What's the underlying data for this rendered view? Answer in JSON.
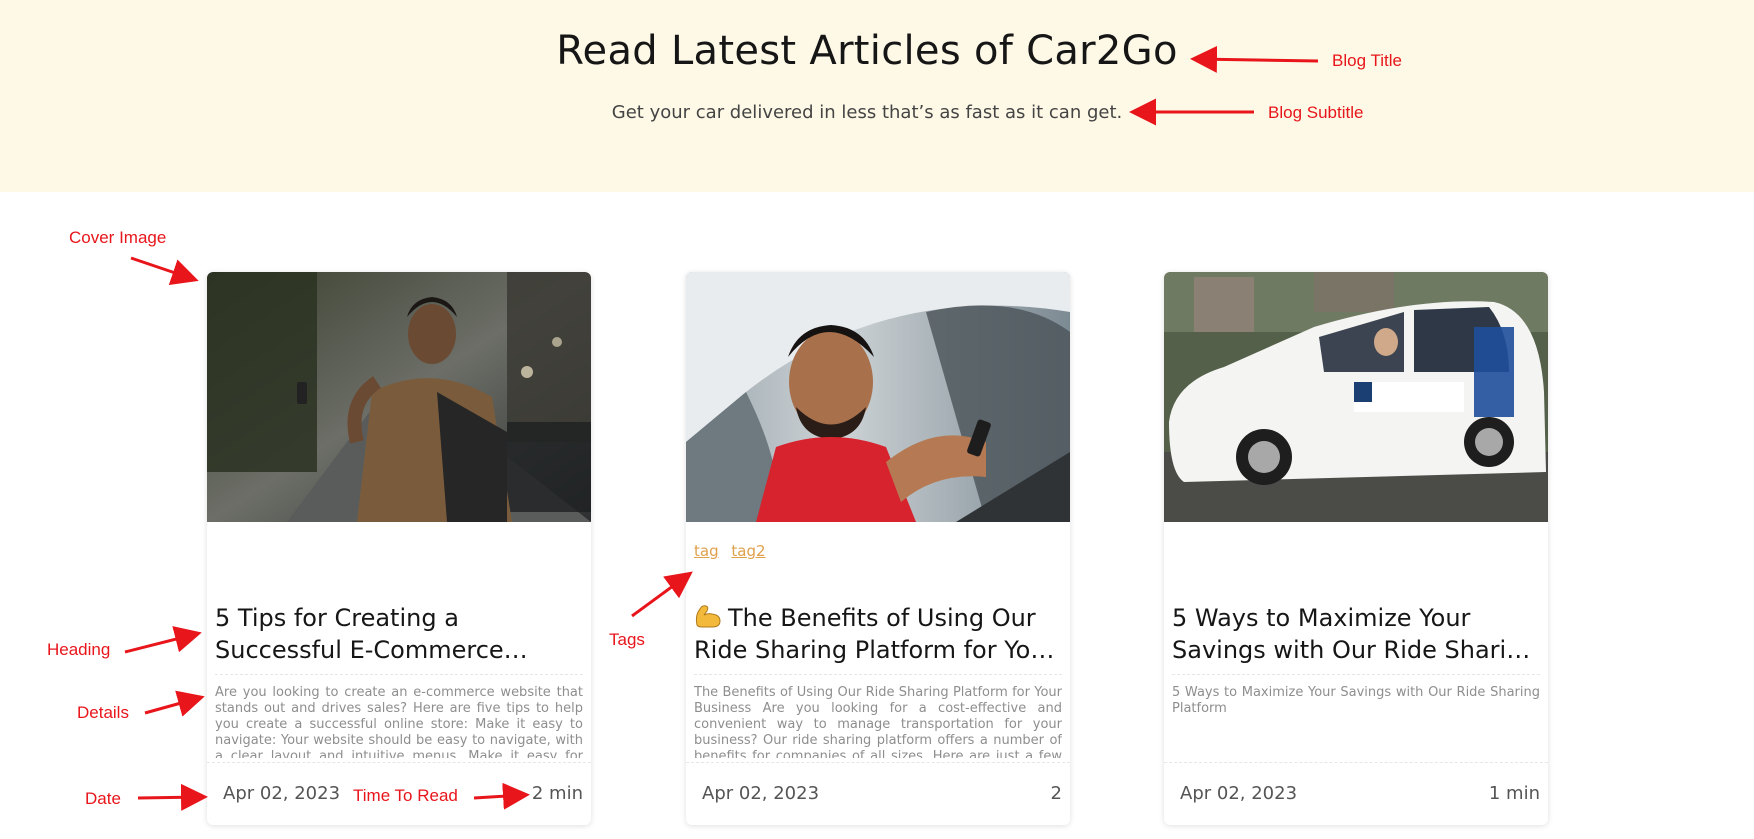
{
  "hero": {
    "title": "Read Latest Articles of Car2Go",
    "subtitle": "Get your car delivered in less that’s as fast as it can get."
  },
  "cards": [
    {
      "cover_alt": "young man holding phone on street",
      "tags": [],
      "heading_line1": "5 Tips for Creating a",
      "heading_line2": "Successful E-Commerce…",
      "details": "Are you looking to create an e-commerce website that stands out and drives sales? Here are five tips to help you create a successful online store: Make it easy to navigate: Your website should be easy to navigate, with a clear layout and intuitive menus. Make it easy for visitors to find wh…",
      "date": "Apr 02, 2023",
      "read_time": "2 min"
    },
    {
      "cover_alt": "man driving car holding phone",
      "tags": [
        "tag",
        "tag2"
      ],
      "heading_icon": "flexed-biceps-icon",
      "heading_line1": "The Benefits of Using Our",
      "heading_line2": "Ride Sharing Platform for You…",
      "details": "The Benefits of Using Our Ride Sharing Platform for Your Business Are you looking for a cost-effective and convenient way to manage transportation for your business? Our ride sharing platform offers a number of benefits for companies of all sizes. Here are just a few reasons why you shoul…",
      "date": "Apr 02, 2023",
      "read_time": "2"
    },
    {
      "cover_alt": "white minivan taxi",
      "tags": [],
      "heading_line1": "5 Ways to Maximize Your",
      "heading_line2": "Savings with Our Ride Sharin…",
      "details": "5 Ways to Maximize Your Savings with Our Ride Sharing Platform",
      "date": "Apr 02, 2023",
      "read_time": "1 min"
    }
  ],
  "annotations": {
    "blog_title": "Blog Title",
    "blog_subtitle": "Blog Subtitle",
    "cover_image": "Cover Image",
    "heading": "Heading",
    "details": "Details",
    "date": "Date",
    "time_to_read": "Time To Read",
    "tags": "Tags"
  },
  "colors": {
    "hero_background": "#fdf9e6",
    "tag_color": "#e0a04c",
    "annotation_color": "#e8151b"
  }
}
